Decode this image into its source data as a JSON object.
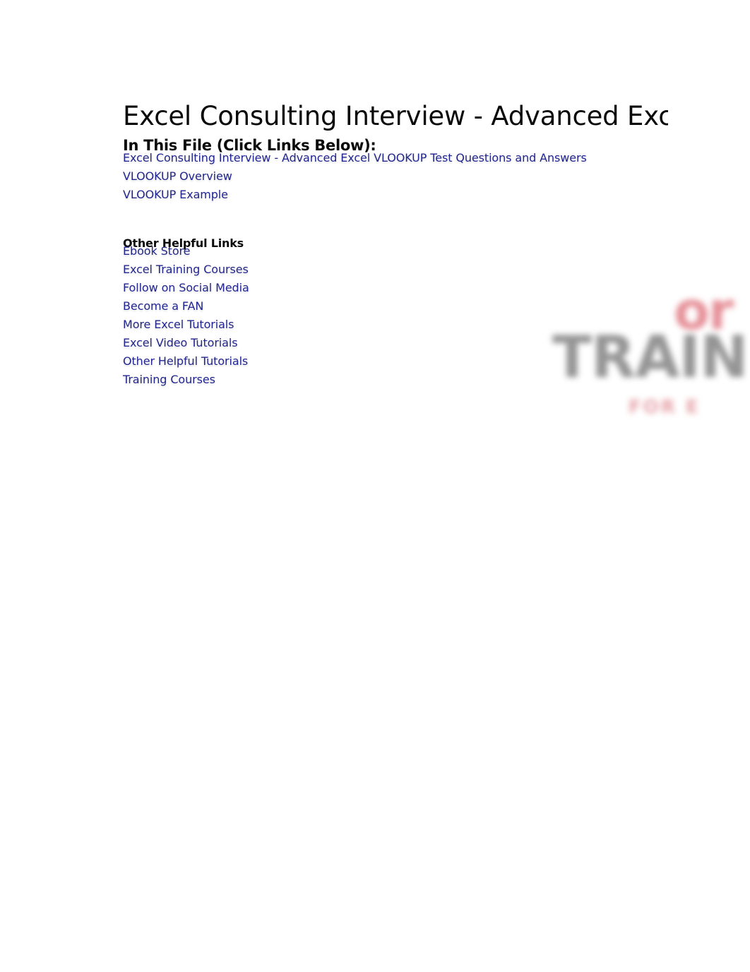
{
  "document": {
    "title": "Excel Consulting Interview - Advanced Exc",
    "section_heading": "In This File (Click Links Below):",
    "sub_heading": "Other Helpful Links"
  },
  "colors": {
    "link": "#22268F",
    "text": "#0A0A0A",
    "page_background": "#FFFFFF",
    "watermark_pink": "#E3868F",
    "watermark_gray": "#8C8C8C"
  },
  "in_this_file_links": [
    {
      "label": "Excel Consulting Interview - Advanced Excel VLOOKUP Test Questions and Answers"
    },
    {
      "label": "VLOOKUP Overview"
    },
    {
      "label": "VLOOKUP Example"
    }
  ],
  "other_helpful_links": [
    {
      "label": "Ebook Store"
    },
    {
      "label": "Excel Training Courses"
    },
    {
      "label": "Follow on Social Media"
    },
    {
      "label": "Become a FAN"
    },
    {
      "label": "More Excel Tutorials"
    },
    {
      "label": "Excel Video Tutorials"
    },
    {
      "label": "Other Helpful Tutorials"
    },
    {
      "label": "Training Courses"
    }
  ],
  "watermark": {
    "line1": "or",
    "line2": "TRAIN",
    "line3": "FOR E"
  }
}
